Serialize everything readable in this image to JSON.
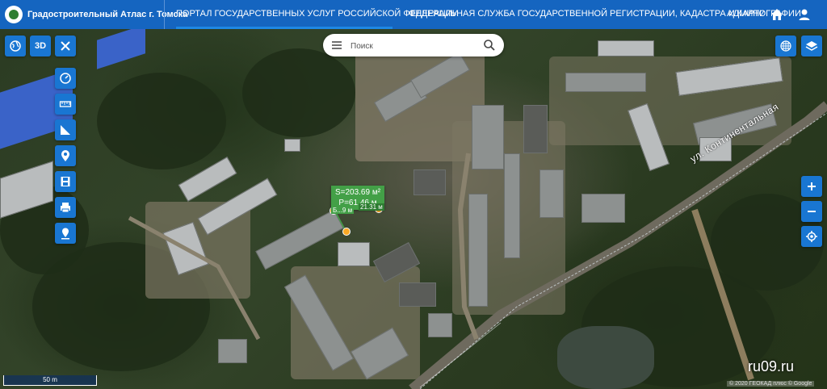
{
  "header": {
    "app_title": "Градостроительный Атлас г. Томска",
    "nav": [
      "ПОРТАЛ ГОСУДАРСТВЕННЫХ УСЛУГ РОССИЙСКОЙ ФЕДЕРАЦИИ",
      "ФЕДЕРАЛЬНАЯ СЛУЖБА ГОСУДАРСТВЕННОЙ РЕГИСТРАЦИИ, КАДАСТРА И КАРТОГРАФИИ",
      "АДМИНИСТ"
    ],
    "icons": [
      "home-icon",
      "user-icon"
    ]
  },
  "controls": {
    "top_left": {
      "globe": "globe-icon",
      "mode_3d": "3D",
      "close": "close-icon"
    },
    "tools": [
      "gauge-icon",
      "ruler-icon",
      "area-icon",
      "pin-icon",
      "save-icon",
      "print-icon",
      "location-pin-icon"
    ],
    "top_right": [
      "grid-icon",
      "layers-icon"
    ],
    "zoom": [
      "zoom-in-icon",
      "zoom-out-icon",
      "locate-icon"
    ]
  },
  "search": {
    "placeholder": "Поиск"
  },
  "measurement": {
    "area": "S=203.69 м²",
    "perimeter": "P=61.46 м",
    "side_a": "Б...9 м",
    "side_b": "21.31 м"
  },
  "map": {
    "street_label": "ул. Континентальная",
    "scale_label": "50 m",
    "watermark": "ru09.ru",
    "attribution": "© 2020 ГЕОКАД плюс © Google"
  },
  "colors": {
    "topbar": "#1565c0",
    "button": "#1976d2",
    "measure": "#43a047",
    "vertex": "#f9a825"
  }
}
